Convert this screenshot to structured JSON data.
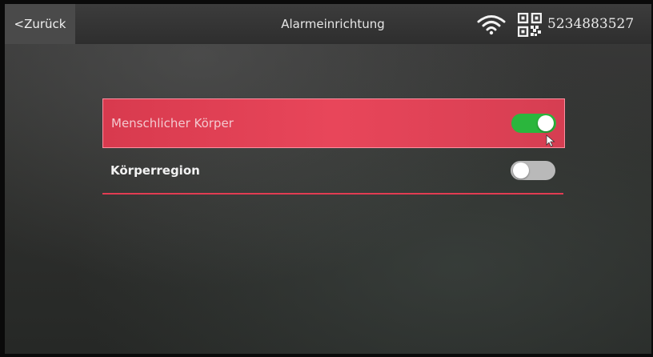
{
  "header": {
    "back_label": "<Zurück",
    "title": "Alarmeinrichtung",
    "wifi_icon": "wifi-icon",
    "qr_icon": "qr-code-icon",
    "device_id": "5234883527"
  },
  "settings": {
    "items": [
      {
        "label": "Menschlicher Körper",
        "enabled": true,
        "selected": true
      },
      {
        "label": "Körperregion",
        "enabled": false,
        "selected": false
      }
    ]
  },
  "colors": {
    "highlight": "#e8465a",
    "toggle_on": "#2bb63d",
    "toggle_off": "#b9b9b9",
    "divider": "#e23c52"
  }
}
